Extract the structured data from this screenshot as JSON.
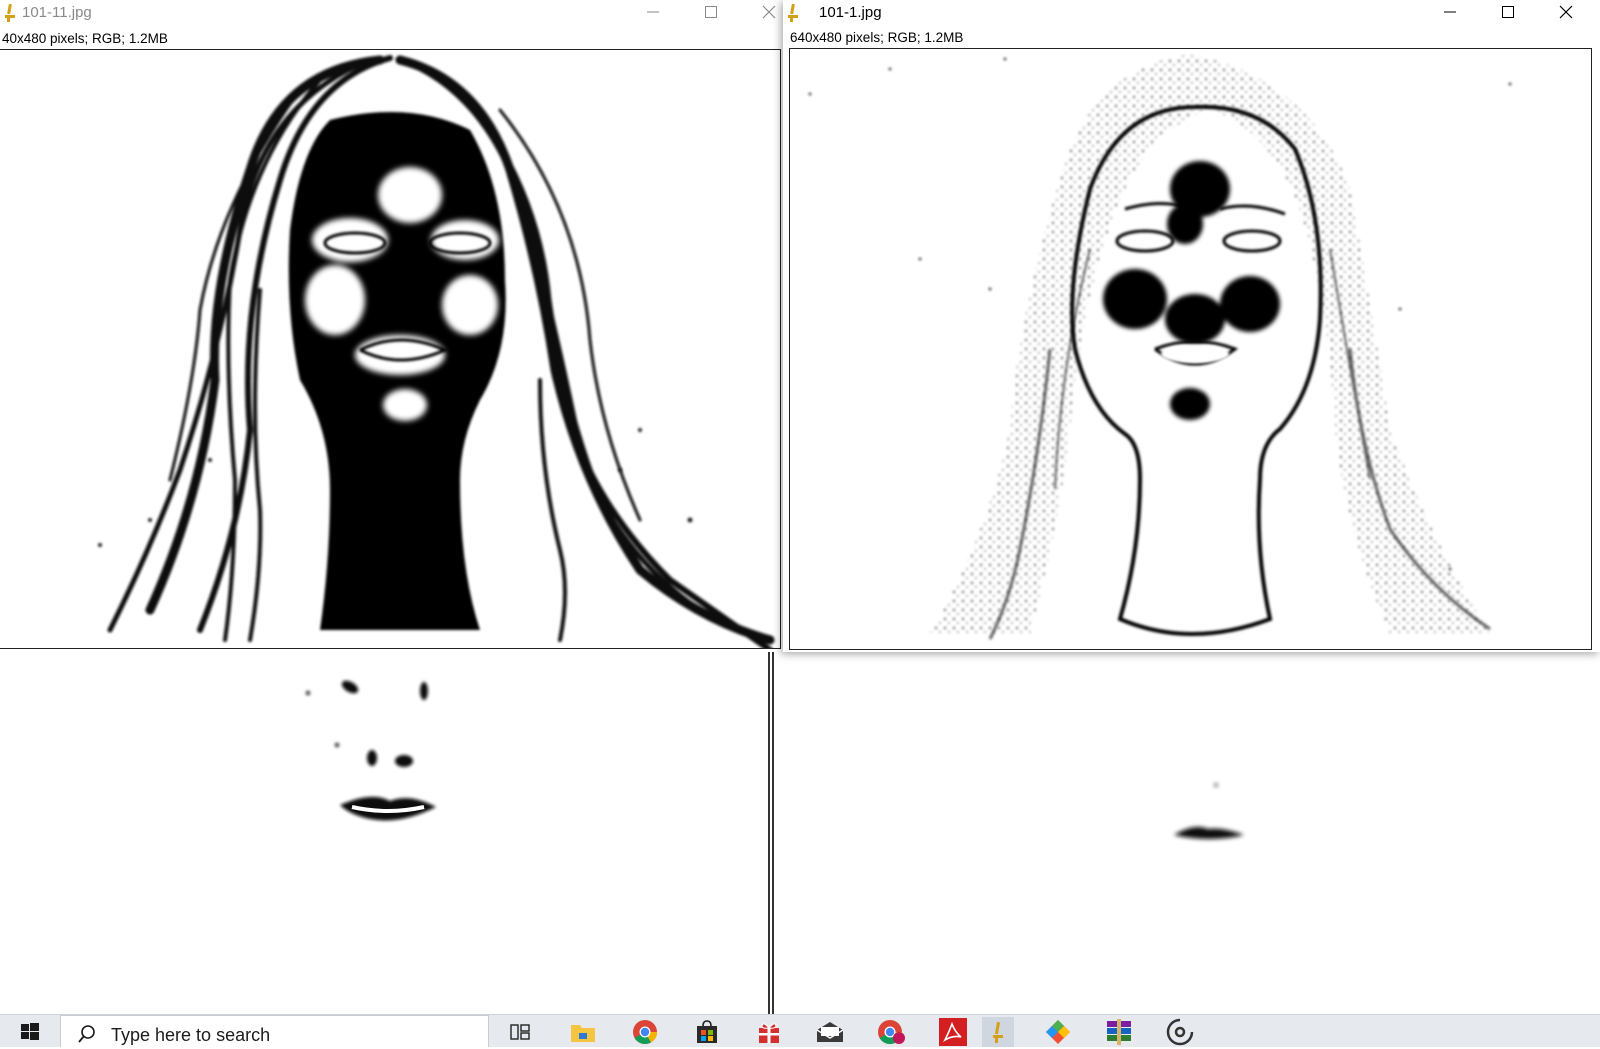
{
  "windows": [
    {
      "title": "101-11.jpg",
      "info": "40x480 pixels; RGB; 1.2MB",
      "active": false,
      "title_color": "#8a8a8a"
    },
    {
      "title": "101-1.jpg",
      "info": "640x480 pixels; RGB; 1.2MB",
      "active": true,
      "title_color": "#000000"
    }
  ],
  "window_controls": [
    "minimize-icon",
    "maximize-icon",
    "close-icon"
  ],
  "taskbar": {
    "search_placeholder": "Type here to search",
    "icons": [
      "start-icon",
      "task-view-icon",
      "file-explorer-icon",
      "chrome-icon",
      "microsoft-store-icon",
      "gift-app-icon",
      "mail-icon",
      "chrome-profile-icon",
      "acrobat-reader-icon",
      "imagej-icon",
      "git-icon",
      "winrar-icon",
      "media-player-icon"
    ]
  },
  "colors": {
    "taskbar_bg": "#e6e9ee",
    "imagej_icon": "#d4a017",
    "acrobat_red": "#d31f1f",
    "chrome_red": "#db4437",
    "chrome_yellow": "#f4b400",
    "chrome_green": "#0f9d58",
    "chrome_blue": "#4285f4"
  }
}
